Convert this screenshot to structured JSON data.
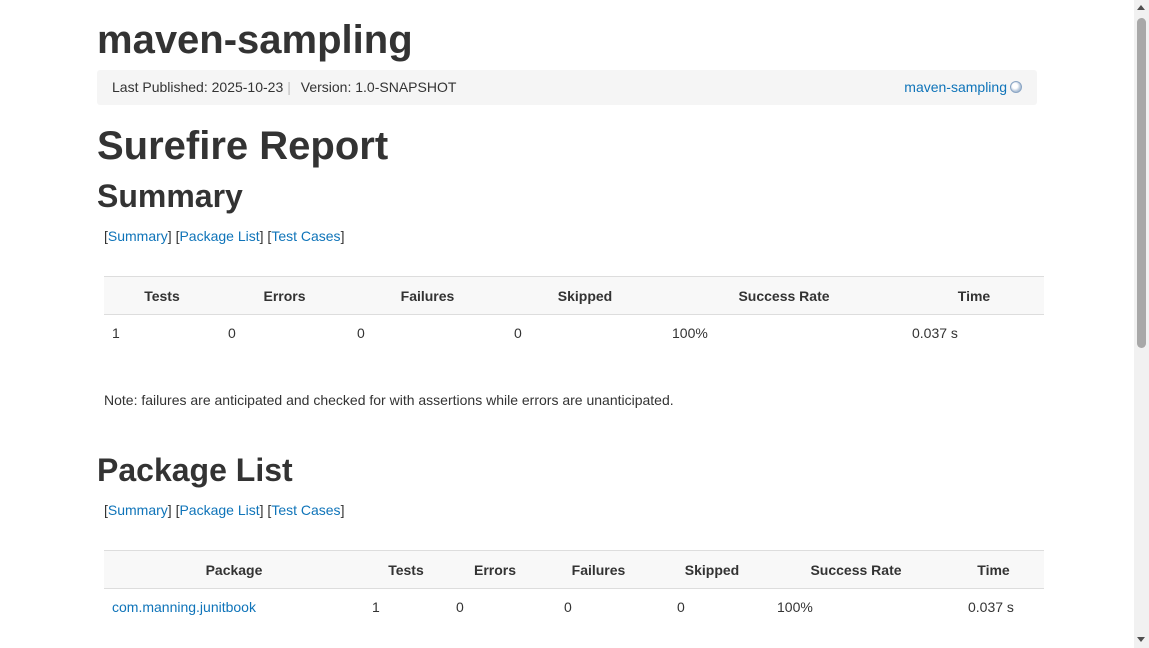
{
  "header": {
    "project_title": "maven-sampling",
    "last_published": "Last Published: 2025-10-23",
    "divider": "|",
    "version": "Version: 1.0-SNAPSHOT",
    "project_link": "maven-sampling",
    "project_link_icon": "globe-icon"
  },
  "report": {
    "title": "Surefire Report"
  },
  "summary": {
    "heading": "Summary",
    "nav": {
      "summary": "Summary",
      "package_list": "Package List",
      "test_cases": "Test Cases"
    },
    "columns": [
      "Tests",
      "Errors",
      "Failures",
      "Skipped",
      "Success Rate",
      "Time"
    ],
    "row": [
      "1",
      "0",
      "0",
      "0",
      "100%",
      "0.037 s"
    ],
    "note": "Note: failures are anticipated and checked for with assertions while errors are unanticipated."
  },
  "package_list": {
    "heading": "Package List",
    "nav": {
      "summary": "Summary",
      "package_list": "Package List",
      "test_cases": "Test Cases"
    },
    "columns": [
      "Package",
      "Tests",
      "Errors",
      "Failures",
      "Skipped",
      "Success Rate",
      "Time"
    ],
    "rows": [
      [
        "com.manning.junitbook",
        "1",
        "0",
        "0",
        "0",
        "100%",
        "0.037 s"
      ]
    ]
  },
  "colors": {
    "link": "#0f74b9",
    "text": "#333333",
    "breadcrumb_bg": "#f5f5f5"
  }
}
